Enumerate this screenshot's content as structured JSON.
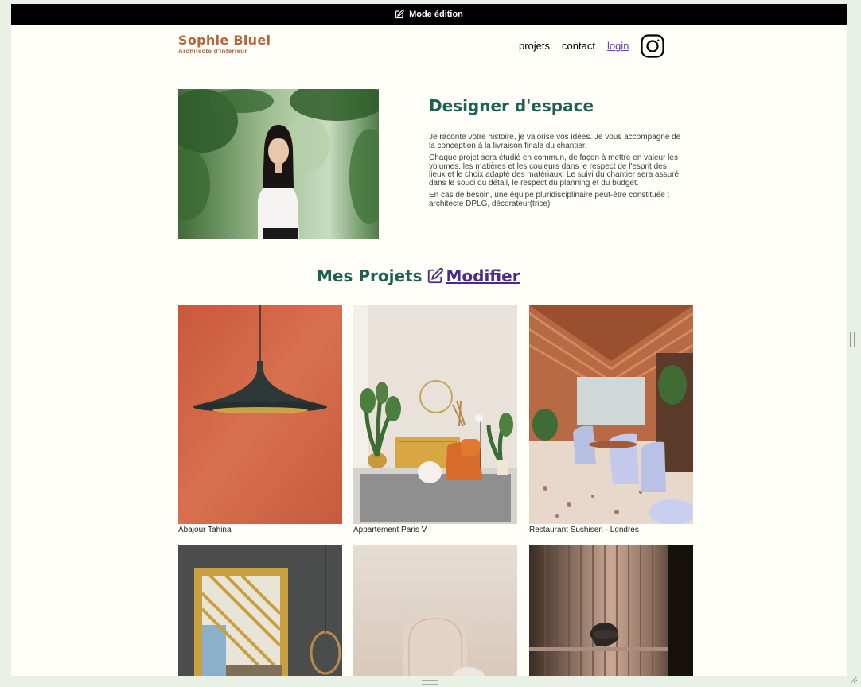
{
  "edit_bar": {
    "label": "Mode édition"
  },
  "header": {
    "brand_name": "Sophie Bluel",
    "brand_subtitle": "Architecte d'intérieur",
    "nav": [
      {
        "label": "projets"
      },
      {
        "label": "contact"
      },
      {
        "label": "login"
      }
    ]
  },
  "intro": {
    "title": "Designer d'espace",
    "paragraphs": [
      "Je raconte votre histoire, je valorise vos idées. Je vous accompagne de la conception à la livraison finale du chantier.",
      "Chaque projet sera étudié en commun, de façon à mettre en valeur les volumes, les matières et les couleurs dans le respect de l'esprit des lieux et le choix adapté des matériaux. Le suivi du chantier sera assuré dans le souci du détail, le respect du planning et du budget.",
      "En cas de besoin, une équipe pluridisciplinaire peut-être constituée : architecte DPLG, décorateur(trice)"
    ]
  },
  "projects": {
    "title": "Mes Projets",
    "modify_label": "Modifier",
    "items": [
      {
        "caption": "Abajour Tahina"
      },
      {
        "caption": "Appartement Paris V"
      },
      {
        "caption": "Restaurant Sushisen - Londres"
      },
      {
        "caption": ""
      },
      {
        "caption": ""
      },
      {
        "caption": ""
      }
    ]
  },
  "colors": {
    "brand": "#b1663c",
    "heading": "#1d6154",
    "link": "#6b3ea8",
    "edit_bar": "#000000"
  },
  "icons": {
    "edit": "pen-square-icon",
    "instagram": "instagram-icon"
  }
}
